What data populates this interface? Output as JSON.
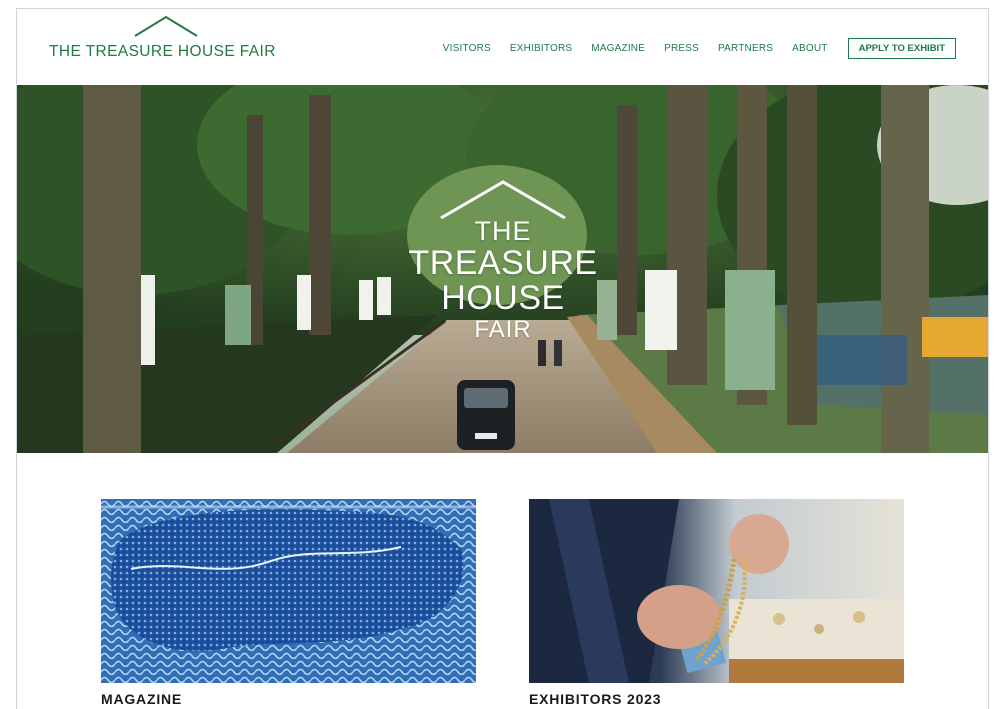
{
  "brand": {
    "logo_text": "THE TREASURE HOUSE FAIR",
    "color": "#1f7a46"
  },
  "nav": {
    "items": [
      "VISITORS",
      "EXHIBITORS",
      "MAGAZINE",
      "PRESS",
      "PARTNERS",
      "ABOUT"
    ],
    "cta": "APPLY TO EXHIBIT"
  },
  "hero": {
    "logo_lines": [
      "THE",
      "TREASURE",
      "HOUSE",
      "FAIR"
    ]
  },
  "cards": [
    {
      "title": "MAGAZINE",
      "image": "blue-map-artwork"
    },
    {
      "title": "EXHIBITORS 2023",
      "image": "gold-chain-hands"
    }
  ]
}
